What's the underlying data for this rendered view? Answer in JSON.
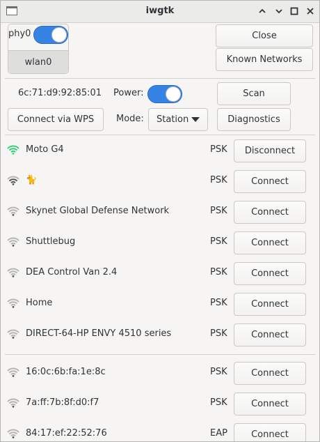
{
  "window": {
    "title": "iwgtk"
  },
  "device": {
    "phy_label": "phy0",
    "phy_power_on": true,
    "interface_label": "wlan0",
    "close_label": "Close",
    "known_networks_label": "Known Networks",
    "mac_address": "6c:71:d9:92:85:01",
    "power_label": "Power:",
    "power_on": true,
    "scan_label": "Scan",
    "wps_label": "Connect via WPS",
    "mode_label": "Mode:",
    "mode_value": "Station",
    "diagnostics_label": "Diagnostics"
  },
  "networks": [
    {
      "ssid": "Moto G4",
      "security": "PSK",
      "action": "Disconnect",
      "signal": 4,
      "connected": true
    },
    {
      "ssid": "🐈",
      "security": "PSK",
      "action": "Connect",
      "signal": 3,
      "connected": false
    },
    {
      "ssid": "Skynet Global Defense Network",
      "security": "PSK",
      "action": "Connect",
      "signal": 1,
      "connected": false
    },
    {
      "ssid": "Shuttlebug",
      "security": "PSK",
      "action": "Connect",
      "signal": 1,
      "connected": false
    },
    {
      "ssid": "DEA Control Van 2.4",
      "security": "PSK",
      "action": "Connect",
      "signal": 1,
      "connected": false
    },
    {
      "ssid": "Home",
      "security": "PSK",
      "action": "Connect",
      "signal": 1,
      "connected": false
    },
    {
      "ssid": "DIRECT-64-HP ENVY 4510 series",
      "security": "PSK",
      "action": "Connect",
      "signal": 1,
      "connected": false
    }
  ],
  "hidden_networks": [
    {
      "address": "16:0c:6b:fa:1e:8c",
      "security": "PSK",
      "action": "Connect",
      "signal": 1
    },
    {
      "address": "7a:ff:7b:8f:d0:f7",
      "security": "PSK",
      "action": "Connect",
      "signal": 1
    },
    {
      "address": "84:17:ef:22:52:76",
      "security": "EAP",
      "action": "Connect",
      "signal": 1
    }
  ],
  "colors": {
    "accent": "#3584e4",
    "connected_signal": "#33d17a",
    "signal_strong": "#555753",
    "signal_weak": "#b5b5b3"
  },
  "icons": {
    "window": "window-icon",
    "minimize": "minimize-icon",
    "maximize": "maximize-icon",
    "close": "close-icon",
    "wifi": "wifi-signal-icon",
    "dropdown": "chevron-down-icon"
  }
}
